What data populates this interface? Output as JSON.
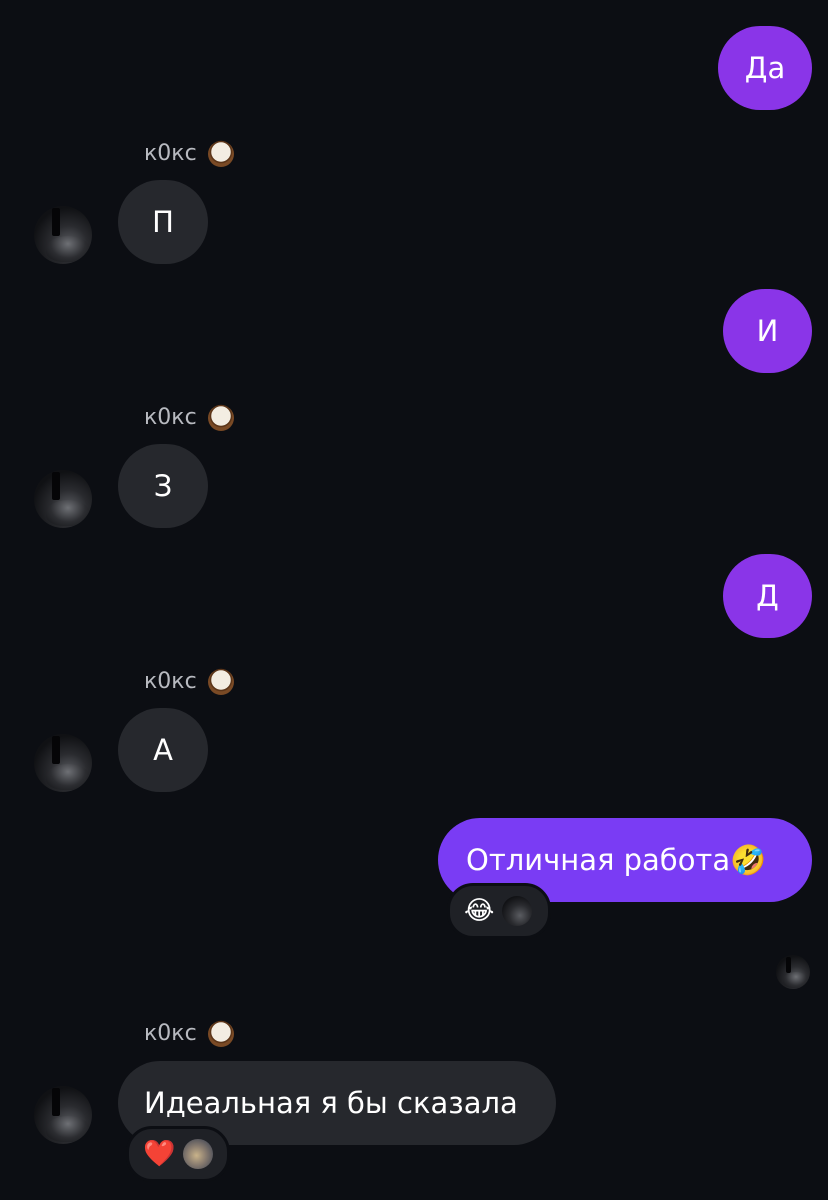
{
  "contact": {
    "name": "к0кс"
  },
  "messages": [
    {
      "id": "m1",
      "direction": "outgoing",
      "text": "Да"
    },
    {
      "id": "m2",
      "direction": "incoming",
      "text": "П"
    },
    {
      "id": "m3",
      "direction": "outgoing",
      "text": "И"
    },
    {
      "id": "m4",
      "direction": "incoming",
      "text": "З"
    },
    {
      "id": "m5",
      "direction": "outgoing",
      "text": "Д"
    },
    {
      "id": "m6",
      "direction": "incoming",
      "text": "А"
    },
    {
      "id": "m7",
      "direction": "outgoing",
      "text": "Отличная работа🤣",
      "reactions": [
        "😂"
      ]
    },
    {
      "id": "m8",
      "direction": "incoming",
      "text": "Идеальная я бы сказала",
      "reactions": [
        "❤️"
      ]
    }
  ],
  "colors": {
    "background": "#0c0e13",
    "outgoing_bubble": "#8a35e8",
    "outgoing_bubble_alt": "#7a3cf4",
    "incoming_bubble": "#26282d",
    "reaction_pill": "#1f2126",
    "name_text": "#b8bac0"
  },
  "icons": {
    "name_emoji": "coconut-icon",
    "avatar": "user-avatar",
    "seen": "seen-avatar-icon"
  }
}
